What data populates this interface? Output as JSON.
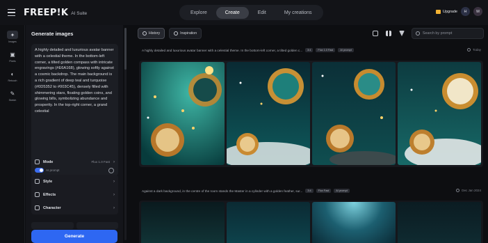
{
  "topbar": {
    "logo": "FREEP!K",
    "logo_sub": "AI Suite",
    "nav": [
      "Explore",
      "Create",
      "Edit",
      "My creations"
    ],
    "active_nav": "Create",
    "upgrade": "Upgrade",
    "avatar1": "H",
    "avatar2": "M"
  },
  "rail": [
    {
      "label": "Images",
      "icon": "image-icon"
    },
    {
      "label": "Pixels",
      "icon": "pixels-icon"
    },
    {
      "label": "Retouch",
      "icon": "retouch-icon"
    },
    {
      "label": "Sketch",
      "icon": "sketch-icon"
    }
  ],
  "panel": {
    "title": "Generate images",
    "prompt": "A highly detailed and luxurious avatar banner with a celestial theme. In the bottom-left corner, a tilted golden compass with intricate engravings (#E6A168), glowing softly against a cosmic backdrop. The main background is a rich gradient of deep teal and turquoise (#0D5352 to #003C45), densely filled with shimmering stars, floating golden coins, and glowing bills, symbolizing abundance and prosperity. In the top-right corner, a grand celestial",
    "ai_label": "AI prompt",
    "mode_label": "Mode",
    "mode_value": "Flux 1.0 Fast",
    "style_label": "Style",
    "effects_label": "Effects",
    "character_label": "Character",
    "generate": "Generate"
  },
  "main": {
    "history": "History",
    "inspiration": "Inspiration",
    "search_placeholder": "Search by prompt",
    "batch1": {
      "prompt": "A highly detailed and luxurious avatar banner with a celestial theme. In the bottom-left corner, a tilted golden c...",
      "tags": [
        "3:4",
        "Flux 1.0 Fast",
        "AI prompt"
      ],
      "date": "Today"
    },
    "batch2": {
      "prompt": "Against a dark background, in the centre of the room stands the Master in a cylinder with a golden feather, sur...",
      "tags": [
        "3:4",
        "Flux Fast",
        "AI prompt"
      ],
      "date": "Dec Jan 2024"
    }
  },
  "colors": {
    "accent": "#2e67f2",
    "bg": "#0d0e11",
    "panel": "#14151a"
  }
}
